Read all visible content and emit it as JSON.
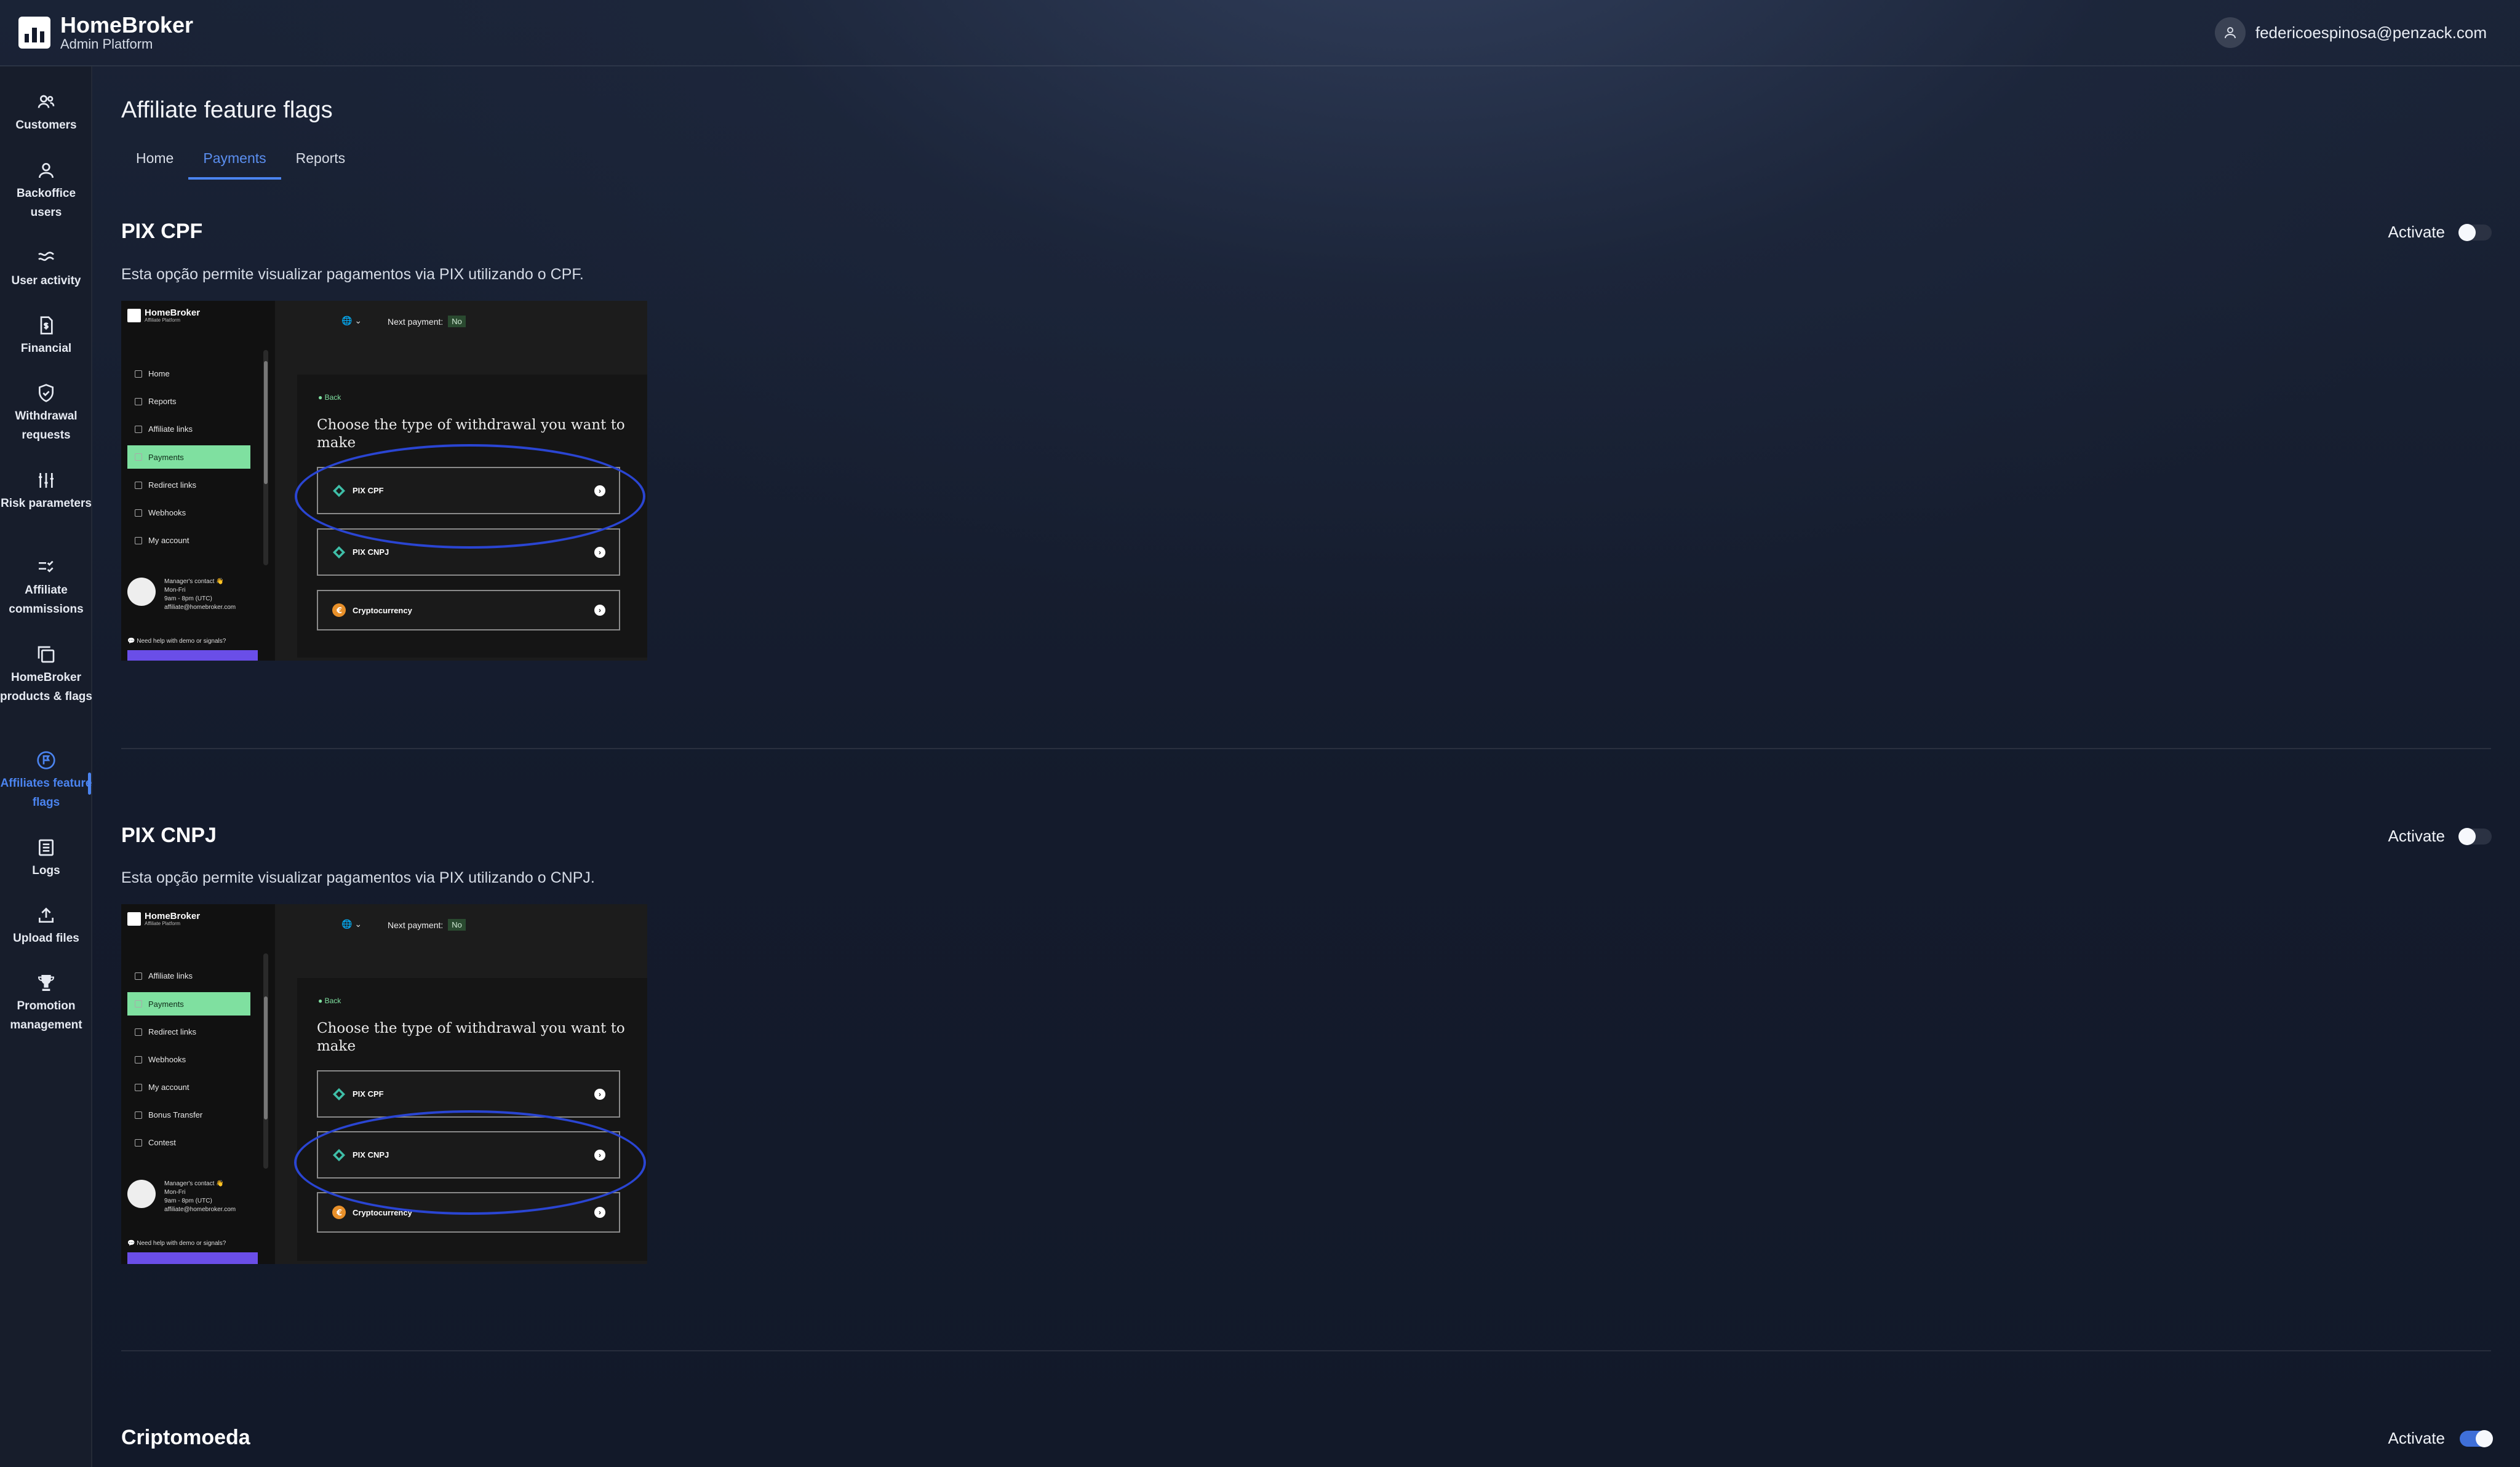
{
  "brand": {
    "name": "HomeBroker",
    "subtitle": "Admin Platform"
  },
  "user": {
    "email": "federicoespinosa@penzack.com",
    "icon": "user-icon"
  },
  "sidebar": {
    "items": [
      {
        "label": "Customers",
        "icon": "users-icon"
      },
      {
        "label": "Backoffice users",
        "icon": "user-icon"
      },
      {
        "label": "User activity",
        "icon": "activity-icon"
      },
      {
        "label": "Financial",
        "icon": "dollar-document-icon"
      },
      {
        "label": "Withdrawal requests",
        "icon": "shield-check-icon"
      },
      {
        "label": "Risk parameters",
        "icon": "sliders-icon"
      },
      {
        "label": "Affiliate commissions",
        "icon": "checklist-icon"
      },
      {
        "label": "HomeBroker products & flags",
        "icon": "copy-icon"
      },
      {
        "label": "Affiliates feature flags",
        "icon": "flag-circle-icon"
      },
      {
        "label": "Logs",
        "icon": "list-icon"
      },
      {
        "label": "Upload files",
        "icon": "upload-icon"
      },
      {
        "label": "Promotion management",
        "icon": "trophy-icon"
      }
    ],
    "active_index": 8
  },
  "page": {
    "title": "Affiliate feature flags",
    "tabs": [
      "Home",
      "Payments",
      "Reports"
    ],
    "active_tab": "Payments"
  },
  "sections": [
    {
      "title": "PIX CPF",
      "description": "Esta opção permite visualizar pagamentos via PIX utilizando o CPF.",
      "activate_label": "Activate",
      "enabled": false
    },
    {
      "title": "PIX CNPJ",
      "description": "Esta opção permite visualizar pagamentos via PIX utilizando o CNPJ.",
      "activate_label": "Activate",
      "enabled": false
    },
    {
      "title": "Criptomoeda",
      "activate_label": "Activate",
      "enabled": true
    }
  ],
  "preview": {
    "brand": "HomeBroker",
    "brand_sub": "Affiliate Platform",
    "menu_1": [
      "Home",
      "Reports",
      "Affiliate links",
      "Payments",
      "Redirect links",
      "Webhooks",
      "My account"
    ],
    "menu_2": [
      "Affiliate links",
      "Payments",
      "Redirect links",
      "Webhooks",
      "My account",
      "Bonus Transfer",
      "Contest"
    ],
    "contact_title": "Manager's contact 👋",
    "contact_days": "Mon-Fri",
    "contact_hours": "9am - 8pm (UTC)",
    "contact_email": "affiliate@homebroker.com",
    "help_text": "💬 Need help with demo or signals?",
    "next_payment_label": "Next payment:",
    "next_payment_value": "No",
    "back_label": "Back",
    "question": "Choose the type of withdrawal you want to make",
    "options": [
      "PIX CPF",
      "PIX CNPJ",
      "Cryptocurrency"
    ]
  },
  "colors": {
    "accent": "#4b84f0",
    "highlight_ellipse": "#2a45d2",
    "preview_active": "#7fe0a0"
  }
}
